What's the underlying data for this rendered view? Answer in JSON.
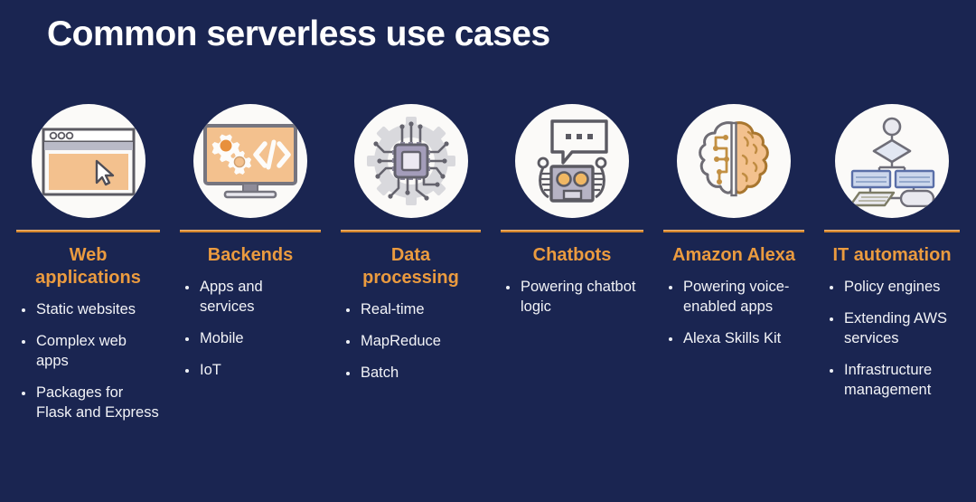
{
  "slide": {
    "title": "Common serverless use cases",
    "background_color": "#1a2551",
    "accent_color": "#eb9b3f",
    "rule_color": "#d4852c",
    "text_color": "#f2f3f7"
  },
  "columns": [
    {
      "icon": "browser-window-cursor-icon",
      "heading": "Web applications",
      "bullets": [
        "Static websites",
        "Complex web apps",
        "Packages for Flask and Express"
      ]
    },
    {
      "icon": "monitor-gears-code-icon",
      "heading": "Backends",
      "bullets": [
        "Apps and services",
        "Mobile",
        "IoT"
      ]
    },
    {
      "icon": "cpu-chip-gear-icon",
      "heading": "Data processing",
      "bullets": [
        "Real-time",
        "MapReduce",
        "Batch"
      ]
    },
    {
      "icon": "chatbot-robot-icon",
      "heading": "Chatbots",
      "bullets": [
        "Powering chatbot logic"
      ]
    },
    {
      "icon": "brain-circuit-icon",
      "heading": "Amazon Alexa",
      "bullets": [
        "Powering voice-enabled apps",
        "Alexa Skills Kit"
      ]
    },
    {
      "icon": "flowchart-automation-icon",
      "heading": "IT automation",
      "bullets": [
        "Policy engines",
        "Extending AWS services",
        "Infrastructure management"
      ]
    }
  ]
}
